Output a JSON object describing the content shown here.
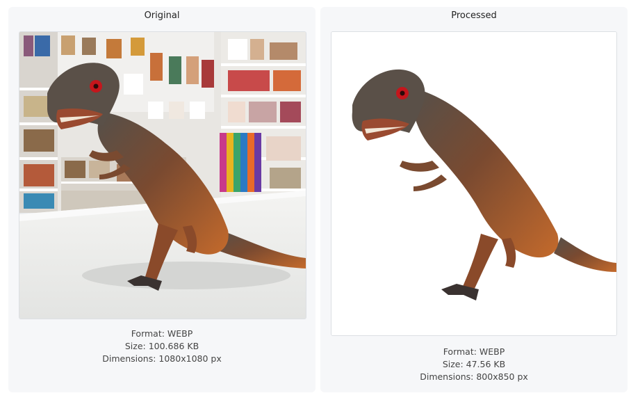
{
  "original": {
    "title": "Original",
    "format_label": "Format: WEBP",
    "size_label": "Size: 100.686 KB",
    "dimensions_label": "Dimensions: 1080x1080 px"
  },
  "processed": {
    "title": "Processed",
    "format_label": "Format: WEBP",
    "size_label": "Size: 47.56 KB",
    "dimensions_label": "Dimensions: 800x850 px"
  },
  "colors": {
    "panel_background": "#f6f7f9",
    "frame_border": "#dcdfe3",
    "dinosaur_body": "#7a4a30",
    "dinosaur_belly": "#c46a2c",
    "dinosaur_back": "#4e4a45",
    "dinosaur_eye": "#c4161c"
  }
}
